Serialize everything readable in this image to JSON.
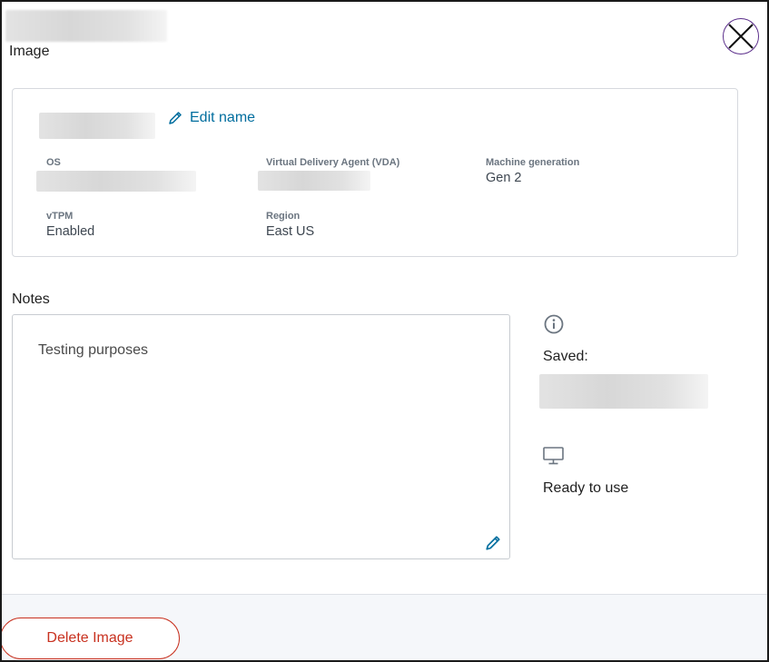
{
  "header": {
    "subtitle": "Image"
  },
  "card": {
    "edit_name_label": "Edit name",
    "fields": {
      "os": {
        "label": "OS"
      },
      "vda": {
        "label": "Virtual Delivery Agent (VDA)"
      },
      "machine_generation": {
        "label": "Machine generation",
        "value": "Gen 2"
      },
      "vtpm": {
        "label": "vTPM",
        "value": "Enabled"
      },
      "region": {
        "label": "Region",
        "value": "East US"
      }
    }
  },
  "notes": {
    "label": "Notes",
    "text": "Testing purposes"
  },
  "status": {
    "saved_label": "Saved:",
    "ready_text": "Ready to use"
  },
  "footer": {
    "delete_label": "Delete Image"
  },
  "icons": {
    "close": "close-icon",
    "edit": "pencil-icon",
    "info": "info-icon",
    "monitor": "monitor-icon"
  },
  "colors": {
    "link": "#006d9e",
    "danger": "#c8311f",
    "close_border": "#5a2d8a",
    "footer_bg": "#f5f7fa"
  }
}
